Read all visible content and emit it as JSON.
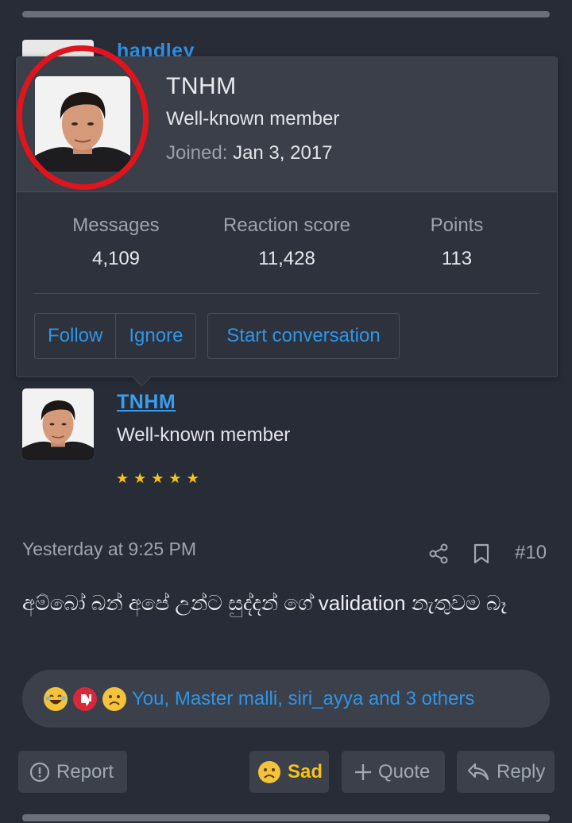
{
  "background_post": {
    "username": "handley"
  },
  "popover": {
    "name": "TNHM",
    "title": "Well-known member",
    "joined_label": "Joined:",
    "joined_date": "Jan 3, 2017",
    "stats": [
      {
        "label": "Messages",
        "value": "4,109"
      },
      {
        "label": "Reaction score",
        "value": "11,428"
      },
      {
        "label": "Points",
        "value": "113"
      }
    ],
    "buttons": {
      "follow": "Follow",
      "ignore": "Ignore",
      "start_conversation": "Start conversation"
    }
  },
  "post": {
    "username": "TNHM",
    "user_title": "Well-known member",
    "stars": 5,
    "time": "Yesterday at 9:25 PM",
    "post_number": "#10",
    "body": "අම්බෝ බන් අපේ උන්ට සුද්දන් ගේ validation නැතුවම බෑ",
    "reactions_text": "You, Master malli, siri_ayya and 3 others",
    "reaction_icons": [
      "laugh-emoji",
      "dislike-emoji",
      "sad-emoji"
    ]
  },
  "actions": {
    "report": "Report",
    "sad": "Sad",
    "quote": "Quote",
    "reply": "Reply"
  },
  "colors": {
    "accent": "#2f95e6",
    "background": "#282c37",
    "highlight_circle": "#e0141c",
    "star": "#f6c21a"
  }
}
